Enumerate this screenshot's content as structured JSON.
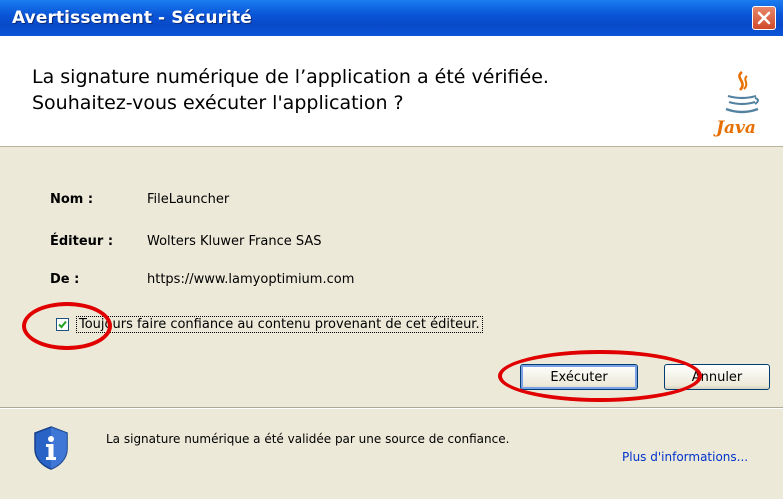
{
  "window": {
    "title": "Avertissement - Sécurité",
    "title_bar_color": "#0a56d8"
  },
  "header": {
    "message_line1": "La signature numérique de l’application a été vérifiée.",
    "message_line2": "Souhaitez-vous exécuter l'application ?",
    "logo_text": "Java",
    "logo_icon": "java-cup-icon"
  },
  "details": {
    "name_label": "Nom :",
    "name_value": "FileLauncher",
    "publisher_label": "Éditeur :",
    "publisher_value": "Wolters Kluwer France SAS",
    "from_label": "De :",
    "from_value": "https://www.lamyoptimium.com"
  },
  "trust_checkbox": {
    "label": "Toujours faire confiance au contenu provenant de cet éditeur.",
    "checked": true
  },
  "buttons": {
    "run": "Exécuter",
    "cancel": "Annuler"
  },
  "footer": {
    "icon": "shield-info-icon",
    "text": "La signature numérique a été validée par une source de confiance.",
    "more_info_link": "Plus d'informations..."
  },
  "annotations": {
    "color": "#e00000"
  }
}
